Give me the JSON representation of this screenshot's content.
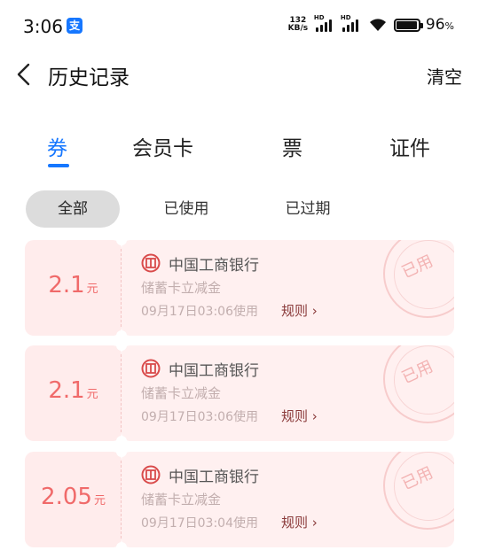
{
  "status_bar": {
    "time": "3:06",
    "app_badge": "支",
    "net_speed_value": "132",
    "net_speed_unit": "KB/s",
    "signal_label_1": "HD",
    "signal_label_2": "HD",
    "battery_percent": "96",
    "battery_unit": "%",
    "battery_level": 0.96
  },
  "header": {
    "title": "历史记录",
    "clear_label": "清空"
  },
  "tabs": [
    {
      "label": "券",
      "active": true
    },
    {
      "label": "会员卡",
      "active": false
    },
    {
      "label": "票",
      "active": false
    },
    {
      "label": "证件",
      "active": false
    }
  ],
  "filters": [
    {
      "label": "全部",
      "active": true
    },
    {
      "label": "已使用",
      "active": false
    },
    {
      "label": "已过期",
      "active": false
    }
  ],
  "coupons": [
    {
      "amount": "2.1",
      "unit": "元",
      "bank": "中国工商银行",
      "desc": "储蓄卡立减金",
      "used_time": "09月17日03:06使用",
      "rules": "规则",
      "stamp": "已用"
    },
    {
      "amount": "2.1",
      "unit": "元",
      "bank": "中国工商银行",
      "desc": "储蓄卡立减金",
      "used_time": "09月17日03:06使用",
      "rules": "规则",
      "stamp": "已用"
    },
    {
      "amount": "2.05",
      "unit": "元",
      "bank": "中国工商银行",
      "desc": "储蓄卡立减金",
      "used_time": "09月17日03:04使用",
      "rules": "规则",
      "stamp": "已用"
    }
  ],
  "colors": {
    "accent": "#1677ff",
    "coupon_amount": "#f06a6a",
    "coupon_bg": "#fff0f0",
    "rules_link": "#8a3a3a"
  }
}
